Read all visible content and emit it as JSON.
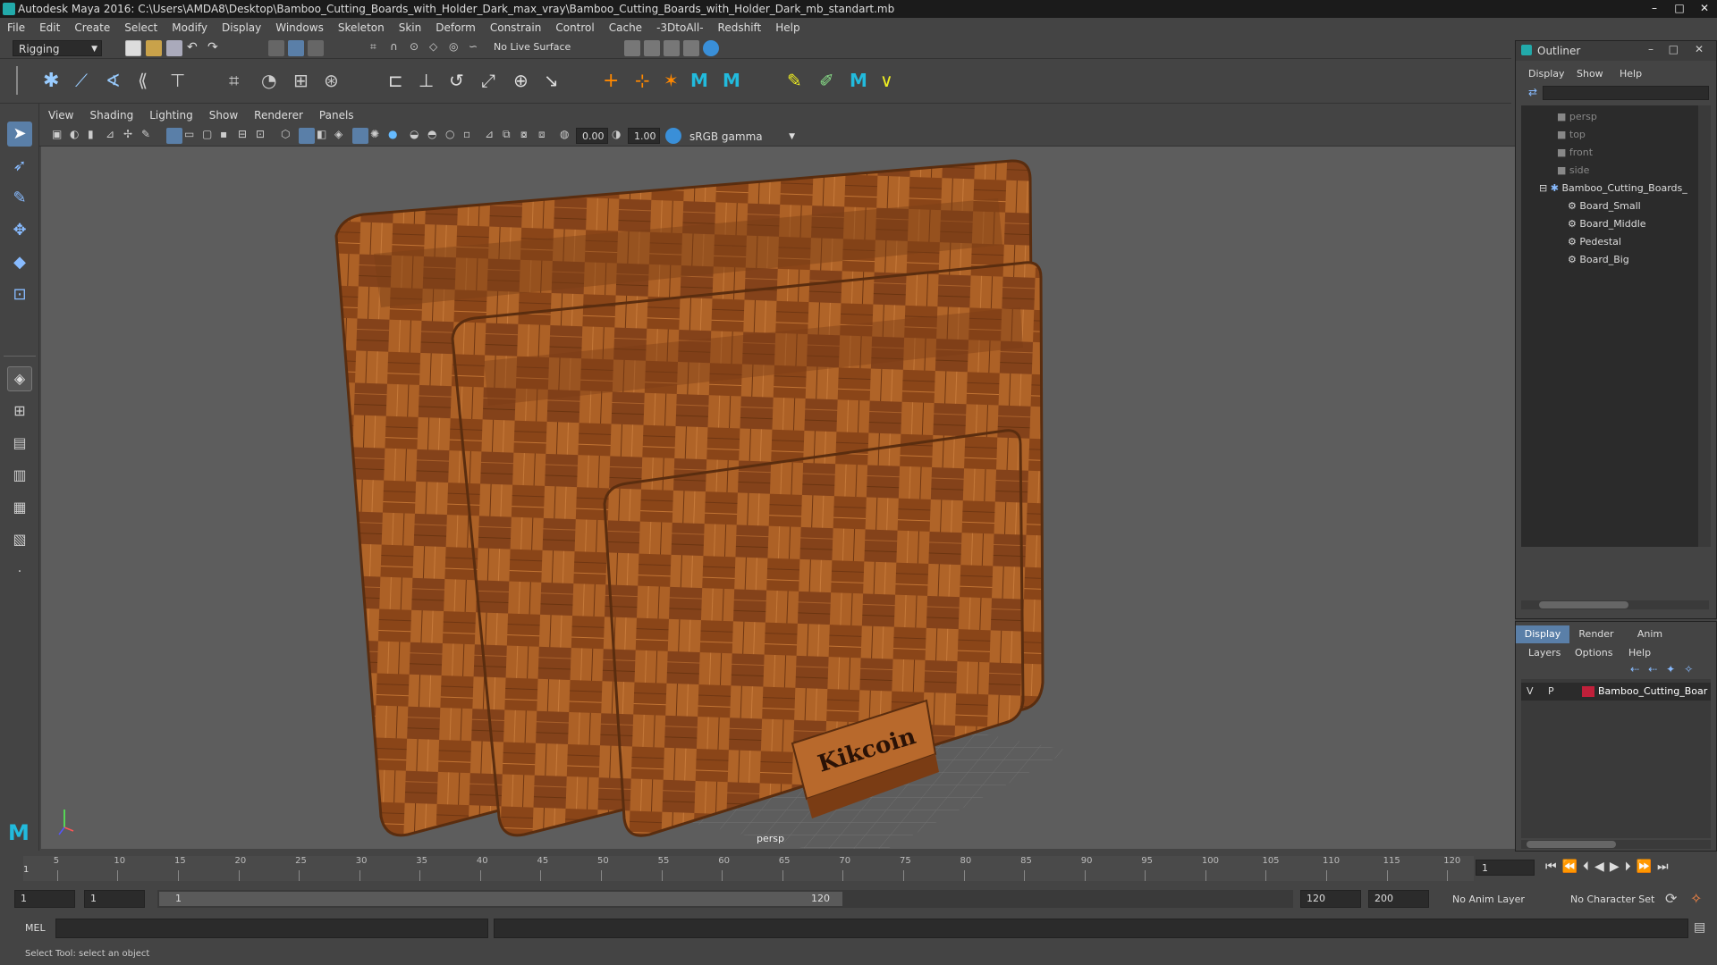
{
  "window": {
    "title": "Autodesk Maya 2016: C:\\Users\\AMDA8\\Desktop\\Bamboo_Cutting_Boards_with_Holder_Dark_max_vray\\Bamboo_Cutting_Boards_with_Holder_Dark_mb_standart.mb",
    "minimize": "–",
    "maximize": "□",
    "close": "✕"
  },
  "menu": [
    "File",
    "Edit",
    "Create",
    "Select",
    "Modify",
    "Display",
    "Windows",
    "Skeleton",
    "Skin",
    "Deform",
    "Constrain",
    "Control",
    "Cache",
    "-3DtoAll-",
    "Redshift",
    "Help"
  ],
  "status": {
    "mode": "Rigging",
    "live_surface": "No Live Surface"
  },
  "viewport": {
    "menu": [
      "View",
      "Shading",
      "Lighting",
      "Show",
      "Renderer",
      "Panels"
    ],
    "exposure": "0.00",
    "gamma": "1.00",
    "color_space": "sRGB gamma",
    "camera_label": "persp",
    "logo_text": "Kikcoin"
  },
  "timeline": {
    "ticks": [
      "5",
      "10",
      "15",
      "20",
      "25",
      "30",
      "35",
      "40",
      "45",
      "50",
      "55",
      "60",
      "65",
      "70",
      "75",
      "80",
      "85",
      "90",
      "95",
      "100",
      "105",
      "110",
      "115",
      "120"
    ],
    "current_frame_marker": "1",
    "current_frame": "1"
  },
  "range": {
    "start": "1",
    "playback_start": "1",
    "slider_start": "1",
    "slider_end": "120",
    "playback_end": "120",
    "end": "200",
    "anim_layer": "No Anim Layer",
    "character_set": "No Character Set"
  },
  "command": {
    "language": "MEL"
  },
  "help_line": "Select Tool: select an object",
  "outliner": {
    "title": "Outliner",
    "menu": [
      "Display",
      "Show",
      "Help"
    ],
    "cameras": [
      "persp",
      "top",
      "front",
      "side"
    ],
    "group": "Bamboo_Cutting_Boards_",
    "children": [
      "Board_Small",
      "Board_Middle",
      "Pedestal",
      "Board_Big"
    ]
  },
  "layers": {
    "tabs": [
      "Display",
      "Render",
      "Anim"
    ],
    "menu": [
      "Layers",
      "Options",
      "Help"
    ],
    "layer_v": "V",
    "layer_p": "P",
    "layer_name": "Bamboo_Cutting_Boar",
    "layer_color": "#c0203a"
  },
  "colors": {
    "accent": "#5aa0d8",
    "wood": "#a85a22"
  }
}
